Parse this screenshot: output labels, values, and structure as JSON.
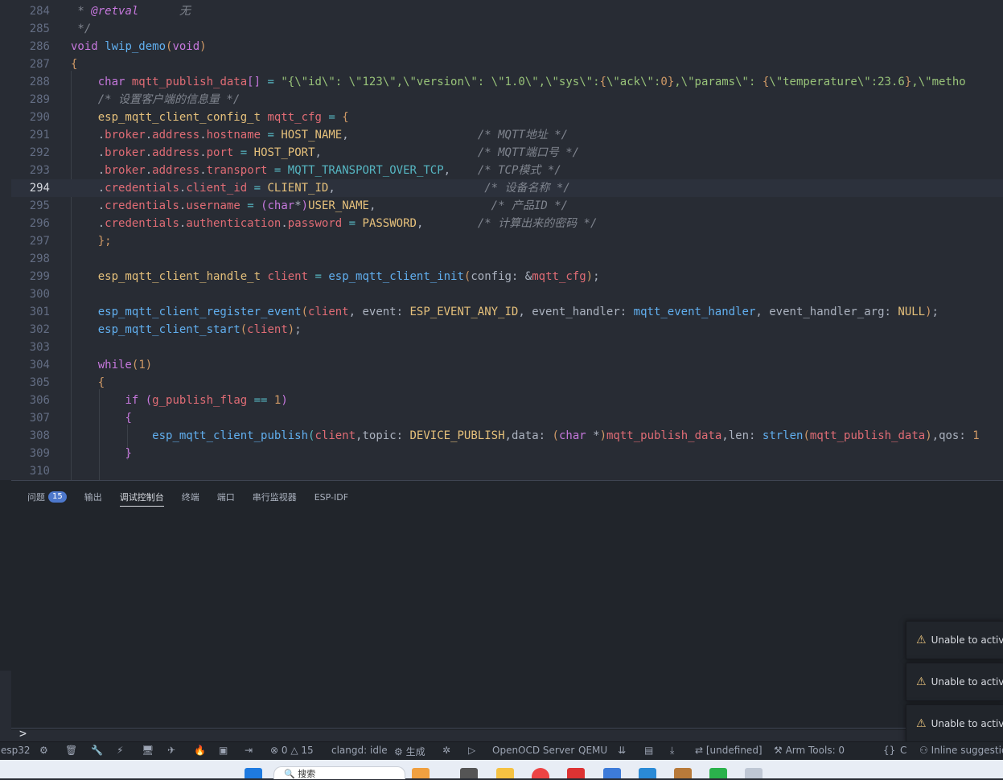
{
  "editor": {
    "current_line": "294",
    "lines": [
      {
        "n": "284"
      },
      {
        "n": "285"
      },
      {
        "n": "286"
      },
      {
        "n": "287"
      },
      {
        "n": "288"
      },
      {
        "n": "289"
      },
      {
        "n": "290"
      },
      {
        "n": "291"
      },
      {
        "n": "292"
      },
      {
        "n": "293"
      },
      {
        "n": "294"
      },
      {
        "n": "295"
      },
      {
        "n": "296"
      },
      {
        "n": "297"
      },
      {
        "n": "298"
      },
      {
        "n": "299"
      },
      {
        "n": "300"
      },
      {
        "n": "301"
      },
      {
        "n": "302"
      },
      {
        "n": "303"
      },
      {
        "n": "304"
      },
      {
        "n": "305"
      },
      {
        "n": "306"
      },
      {
        "n": "307"
      },
      {
        "n": "308"
      },
      {
        "n": "309"
      },
      {
        "n": "310"
      }
    ],
    "code": {
      "l284_a": " * ",
      "l284_b": "@retval",
      "l284_c": "      无",
      "l285": " */",
      "l286_a": "void",
      "l286_b": "lwip_demo",
      "l286_c": "void",
      "l287": "{",
      "l288_a": "char",
      "l288_b": "mqtt_publish_data",
      "l288_c": "\"{\\\"id\\\": \\\"123\\\",\\\"version\\\": \\\"1.0\\\",\\\"sys\\\":",
      "l288_d": "{",
      "l288_e": "\\\"ack\\\":",
      "l288_f": "0",
      "l288_g": "}",
      "l288_h": ",\\\"params\\\": ",
      "l288_i": "{",
      "l288_j": "\\\"temperature\\\":23.6",
      "l288_k": "}",
      "l288_l": ",\\\"metho",
      "l289": "/* 设置客户端的信息量 */",
      "l290_a": "esp_mqtt_client_config_t",
      "l290_b": "mqtt_cfg",
      "l291_a": "broker",
      "l291_b": "address",
      "l291_c": "hostname",
      "l291_d": "HOST_NAME",
      "l291_e": "/* MQTT地址 */",
      "l292_a": "broker",
      "l292_b": "address",
      "l292_c": "port",
      "l292_d": "HOST_PORT",
      "l292_e": "/* MQTT端口号 */",
      "l293_a": "broker",
      "l293_b": "address",
      "l293_c": "transport",
      "l293_d": "MQTT_TRANSPORT_OVER_TCP",
      "l293_e": "/* TCP模式 */",
      "l294_a": "credentials",
      "l294_b": "client_id",
      "l294_c": "CLIENT_ID",
      "l294_e": "/* 设备名称 */",
      "l295_a": "credentials",
      "l295_b": "username",
      "l295_c": "char",
      "l295_d": "USER_NAME",
      "l295_e": "/* 产品ID */",
      "l296_a": "credentials",
      "l296_b": "authentication",
      "l296_c": "password",
      "l296_d": "PASSWORD",
      "l296_e": "/* 计算出来的密码 */",
      "l297": "};",
      "l299_a": "esp_mqtt_client_handle_t",
      "l299_b": "client",
      "l299_c": "esp_mqtt_client_init",
      "l299_d": "config:",
      "l299_e": "mqtt_cfg",
      "l301_a": "esp_mqtt_client_register_event",
      "l301_b": "client",
      "l301_c": "event:",
      "l301_d": "ESP_EVENT_ANY_ID",
      "l301_e": "event_handler:",
      "l301_f": "mqtt_event_handler",
      "l301_g": "event_handler_arg:",
      "l301_h": "NULL",
      "l302_a": "esp_mqtt_client_start",
      "l302_b": "client",
      "l304_a": "while",
      "l304_b": "1",
      "l305": "{",
      "l306_a": "if",
      "l306_b": "g_publish_flag",
      "l306_c": "1",
      "l307": "{",
      "l308_a": "esp_mqtt_client_publish",
      "l308_b": "client",
      "l308_c": "topic:",
      "l308_d": "DEVICE_PUBLISH",
      "l308_e": "data:",
      "l308_f": "char",
      "l308_g": "mqtt_publish_data",
      "l308_h": "len:",
      "l308_i": "strlen",
      "l308_j": "mqtt_publish_data",
      "l308_k": "qos:",
      "l308_l": "1",
      "l309": "}"
    }
  },
  "panel": {
    "tabs": [
      {
        "label": "问题",
        "badge": "15"
      },
      {
        "label": "输出"
      },
      {
        "label": "调试控制台",
        "active": true
      },
      {
        "label": "终端"
      },
      {
        "label": "端口"
      },
      {
        "label": "串行监视器"
      },
      {
        "label": "ESP-IDF"
      }
    ],
    "prompt": ">"
  },
  "notifications": [
    {
      "text": "Unable to activ"
    },
    {
      "text": "Unable to activ"
    },
    {
      "text": "Unable to activ"
    }
  ],
  "statusbar": {
    "target": "esp32",
    "errors": "0",
    "warnings": "15",
    "clangd": "clangd: idle",
    "build": "生成",
    "openocd": "OpenOCD Server",
    "qemu": "QEMU",
    "undefined": "[undefined]",
    "arm_tools": "Arm Tools: 0",
    "lang": "C",
    "inline": "Inline suggestion"
  },
  "taskbar": {
    "search_placeholder": "搜索"
  }
}
